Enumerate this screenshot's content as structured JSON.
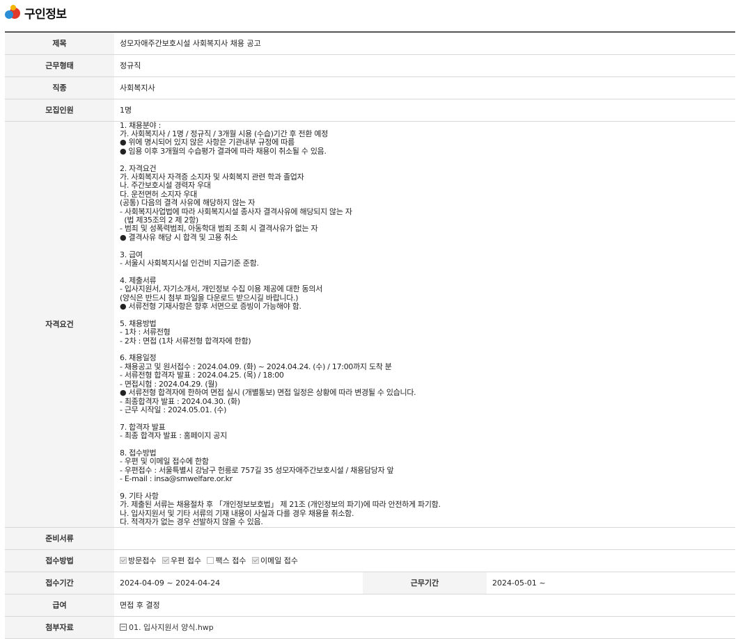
{
  "header": {
    "title": "구인정보"
  },
  "rows": {
    "title": {
      "label": "제목",
      "value": "성모자애주간보호시설 사회복지사 채용 공고"
    },
    "employment_type": {
      "label": "근무형태",
      "value": "정규직"
    },
    "job_type": {
      "label": "직종",
      "value": "사회복지사"
    },
    "headcount": {
      "label": "모집인원",
      "value": "1명"
    },
    "requirements": {
      "label": "자격요건",
      "text": "1. 채용분야 :\n가. 사회복지사 / 1명 / 정규직 / 3개월 시용 (수습)기간 후 전환 예정\n● 위에 명시되어 있지 않은 사항은 기관내부 규정에 따름\n● 임용 이후 3개월의 수습평가 결과에 따라 채용이 취소될 수 있음.\n\n2. 자격요건\n가. 사회복지사 자격증 소지자 및 사회복지 관련 학과 졸업자\n나. 주간보호시설 경력자 우대\n다. 운전면허 소지자 우대\n(공통) 다음의 결격 사유에 해당하지 않는 자\n- 사회복지사업법에 따라 사회복지시설 종사자 결격사유에 해당되지 않는 자\n  (법 제35조의 2 제 2항)\n- 범죄 및 성폭력범죄, 아동학대 범죄 조회 시 결격사유가 없는 자\n● 결격사유 해당 시 합격 및 고용 취소\n\n3. 급여\n- 서울시 사회복지시설 인건비 지급기준 준함.\n\n4. 제출서류\n- 입사지원서, 자기소개서, 개인정보 수집 이용 제공에 대한 동의서\n(양식은 반드시 첨부 파일을 다운로드 받으시길 바랍니다.)\n● 서류전형 기재사항은 향후 서면으로 증빙이 가능해야 함.\n\n5. 채용방법\n- 1차 : 서류전형\n- 2차 : 면접 (1차 서류전형 합격자에 한함)\n\n6. 채용일정\n- 채용공고 및 원서접수 : 2024.04.09. (화) ~ 2024.04.24. (수) / 17:00까지 도착 분\n- 서류전형 합격자 발표 : 2024.04.25. (목) / 18:00\n- 면접시험 : 2024.04.29. (월)\n● 서류전형 합격자에 한하여 면접 실시 (개별통보) 면접 일정은 상황에 따라 변경될 수 있습니다.\n- 최종합격자 발표 : 2024.04.30. (화)\n- 근무 시작일 : 2024.05.01. (수)\n\n7. 합격자 발표\n- 최종 합격자 발표 : 홈페이지 공지\n\n8. 접수방법\n- 우편 및 이메일 접수에 한함\n- 우편접수 : 서울특별시 강남구 헌릉로 757길 35 성모자애주간보호시설 / 채용담당자 앞\n- E-mail : insa@smwelfare.or.kr\n\n9. 기타 사항\n가. 제출된 서류는 채용절차 후 「개인정보보호법」 제 21조 (개인정보의 파기)에 따라 안전하게 파기함.\n나. 입사지원서 및 기타 서류의 기재 내용이 사실과 다를 경우 채용을 취소함.\n다. 적격자가 없는 경우 선발하지 않을 수 있음."
    },
    "documents": {
      "label": "준비서류",
      "value": ""
    },
    "apply_method": {
      "label": "접수방법",
      "options": [
        {
          "label": "방문접수",
          "checked": true
        },
        {
          "label": "우편 접수",
          "checked": true
        },
        {
          "label": "팩스 접수",
          "checked": false
        },
        {
          "label": "이메일 접수",
          "checked": true
        }
      ]
    },
    "apply_period": {
      "label": "접수기간",
      "value": "2024-04-09 ~ 2024-04-24"
    },
    "work_period": {
      "label": "근무기간",
      "value": "2024-05-01 ~"
    },
    "salary": {
      "label": "급여",
      "value": "면접 후 결정"
    },
    "attachment": {
      "label": "첨부자료",
      "file": "01. 입사지원서 양식.hwp"
    }
  }
}
